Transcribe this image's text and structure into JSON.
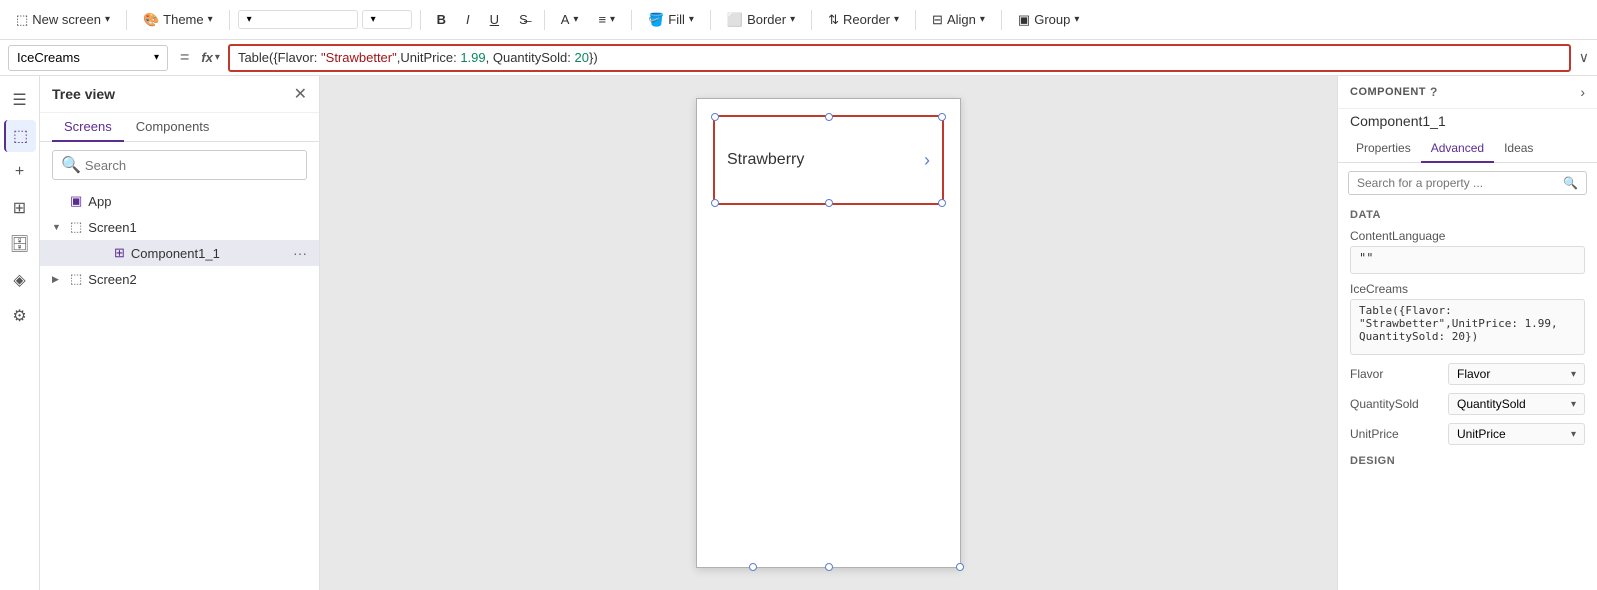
{
  "toolbar": {
    "new_screen_label": "New screen",
    "theme_label": "Theme",
    "bold_label": "B",
    "italic_label": "I",
    "underline_label": "U",
    "strikethrough_label": "—",
    "font_label": "A",
    "align_label": "≡",
    "fill_label": "Fill",
    "border_label": "Border",
    "reorder_label": "Reorder",
    "align_action_label": "Align",
    "group_label": "Group",
    "chevron_down": "∨"
  },
  "formula_bar": {
    "name_box_value": "IceCreams",
    "fx_label": "fx",
    "formula_display": "Table({Flavor: \"Strawbetter\",UnitPrice: 1.99, QuantitySold: 20})",
    "formula_keyword": "Table(",
    "formula_key1": "Flavor",
    "formula_str1": "\"Strawbetter\"",
    "formula_key2": "UnitPrice",
    "formula_num1": "1.99",
    "formula_key3": "QuantitySold",
    "formula_num2": "20",
    "equals_label": "="
  },
  "tree_panel": {
    "title": "Tree view",
    "tabs": [
      {
        "label": "Screens",
        "active": true
      },
      {
        "label": "Components",
        "active": false
      }
    ],
    "search_placeholder": "Search",
    "items": [
      {
        "label": "App",
        "icon": "app",
        "indent": 0,
        "chevron": ""
      },
      {
        "label": "Screen1",
        "icon": "screen",
        "indent": 0,
        "chevron": "▼",
        "expanded": true
      },
      {
        "label": "Component1_1",
        "icon": "component",
        "indent": 2,
        "chevron": "",
        "selected": true
      },
      {
        "label": "Screen2",
        "icon": "screen",
        "indent": 0,
        "chevron": "▶",
        "expanded": false
      }
    ]
  },
  "canvas": {
    "component_text": "Strawberry",
    "arrow": "›"
  },
  "right_panel": {
    "badge": "COMPONENT",
    "component_name": "Component1_1",
    "tabs": [
      {
        "label": "Properties",
        "active": false
      },
      {
        "label": "Advanced",
        "active": true
      },
      {
        "label": "Ideas",
        "active": false
      }
    ],
    "search_placeholder": "Search for a property ...",
    "sections": {
      "data_label": "DATA",
      "design_label": "DESIGN"
    },
    "properties": {
      "content_language_label": "ContentLanguage",
      "content_language_value": "\"\"",
      "ice_creams_label": "IceCreams",
      "ice_creams_value": "Table({Flavor:\n\"Strawbetter\",UnitPrice: 1.99,\nQuantitySold: 20})",
      "flavor_label": "Flavor",
      "flavor_value": "Flavor",
      "quantity_sold_label": "QuantitySold",
      "quantity_sold_value": "QuantitySold",
      "unit_price_label": "UnitPrice",
      "unit_price_value": "UnitPrice"
    }
  },
  "sidebar_icons": {
    "menu_icon": "☰",
    "layers_icon": "⬚",
    "add_icon": "+",
    "components_icon": "⊞",
    "data_icon": "⋯",
    "variables_icon": "◈",
    "settings_icon": "⬡"
  }
}
